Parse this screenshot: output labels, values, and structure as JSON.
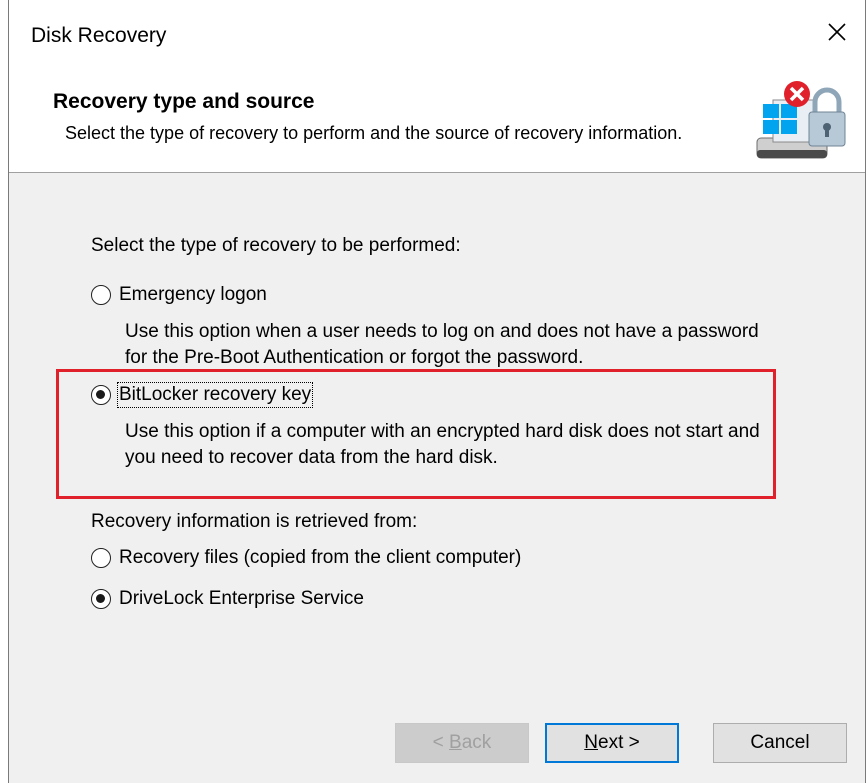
{
  "window": {
    "title": "Disk Recovery"
  },
  "header": {
    "title": "Recovery type and source",
    "subtitle": "Select the type of recovery to perform and the source of recovery information."
  },
  "recovery_type": {
    "prompt": "Select the type of recovery to be performed:",
    "options": [
      {
        "label": "Emergency logon",
        "description": "Use this option when a user needs to log on and does not have a password for the Pre-Boot Authentication or forgot the password.",
        "selected": false
      },
      {
        "label": "BitLocker recovery key",
        "description": "Use this option if a computer with an encrypted hard disk does not start and you need to recover data from the hard disk.",
        "selected": true
      }
    ]
  },
  "recovery_source": {
    "prompt": "Recovery information is retrieved from:",
    "options": [
      {
        "label": "Recovery files (copied from the client computer)",
        "selected": false
      },
      {
        "label": "DriveLock Enterprise Service",
        "selected": true
      }
    ]
  },
  "buttons": {
    "back": {
      "prefix": "< ",
      "mnemonic": "B",
      "rest": "ack"
    },
    "next": {
      "mnemonic": "N",
      "rest": "ext >"
    },
    "cancel": "Cancel"
  },
  "colors": {
    "highlight": "#e0202b",
    "accent": "#0078d7"
  },
  "icons": {
    "close": "close-icon",
    "header": "disk-lock-icon"
  }
}
